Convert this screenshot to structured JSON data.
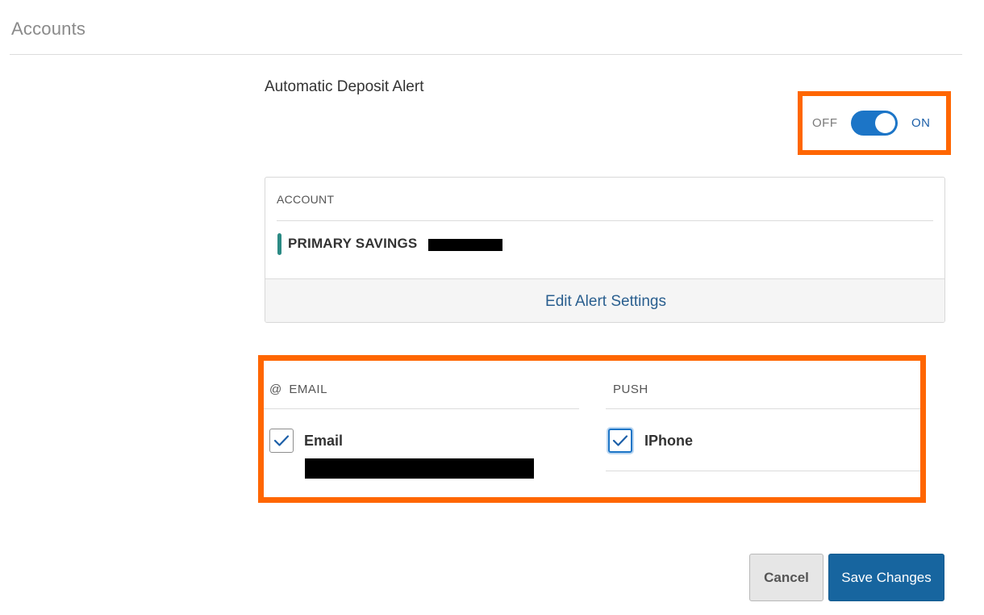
{
  "header": {
    "title": "Accounts"
  },
  "alert": {
    "title": "Automatic Deposit Alert",
    "toggle": {
      "off_label": "OFF",
      "on_label": "ON",
      "state": "on",
      "color": "#1c75c7"
    }
  },
  "account_card": {
    "column_header": "ACCOUNT",
    "account_name": "PRIMARY SAVINGS",
    "edit_link": "Edit Alert Settings"
  },
  "channels": {
    "email": {
      "at_symbol": "@",
      "header": "EMAIL",
      "option_label": "Email",
      "checked": true
    },
    "push": {
      "header": "PUSH",
      "option_label": "IPhone",
      "checked": true
    }
  },
  "actions": {
    "cancel_label": "Cancel",
    "save_label": "Save Changes"
  },
  "colors": {
    "highlight": "#ff6600",
    "primary": "#17659f",
    "account_marker": "#2b8a84"
  }
}
